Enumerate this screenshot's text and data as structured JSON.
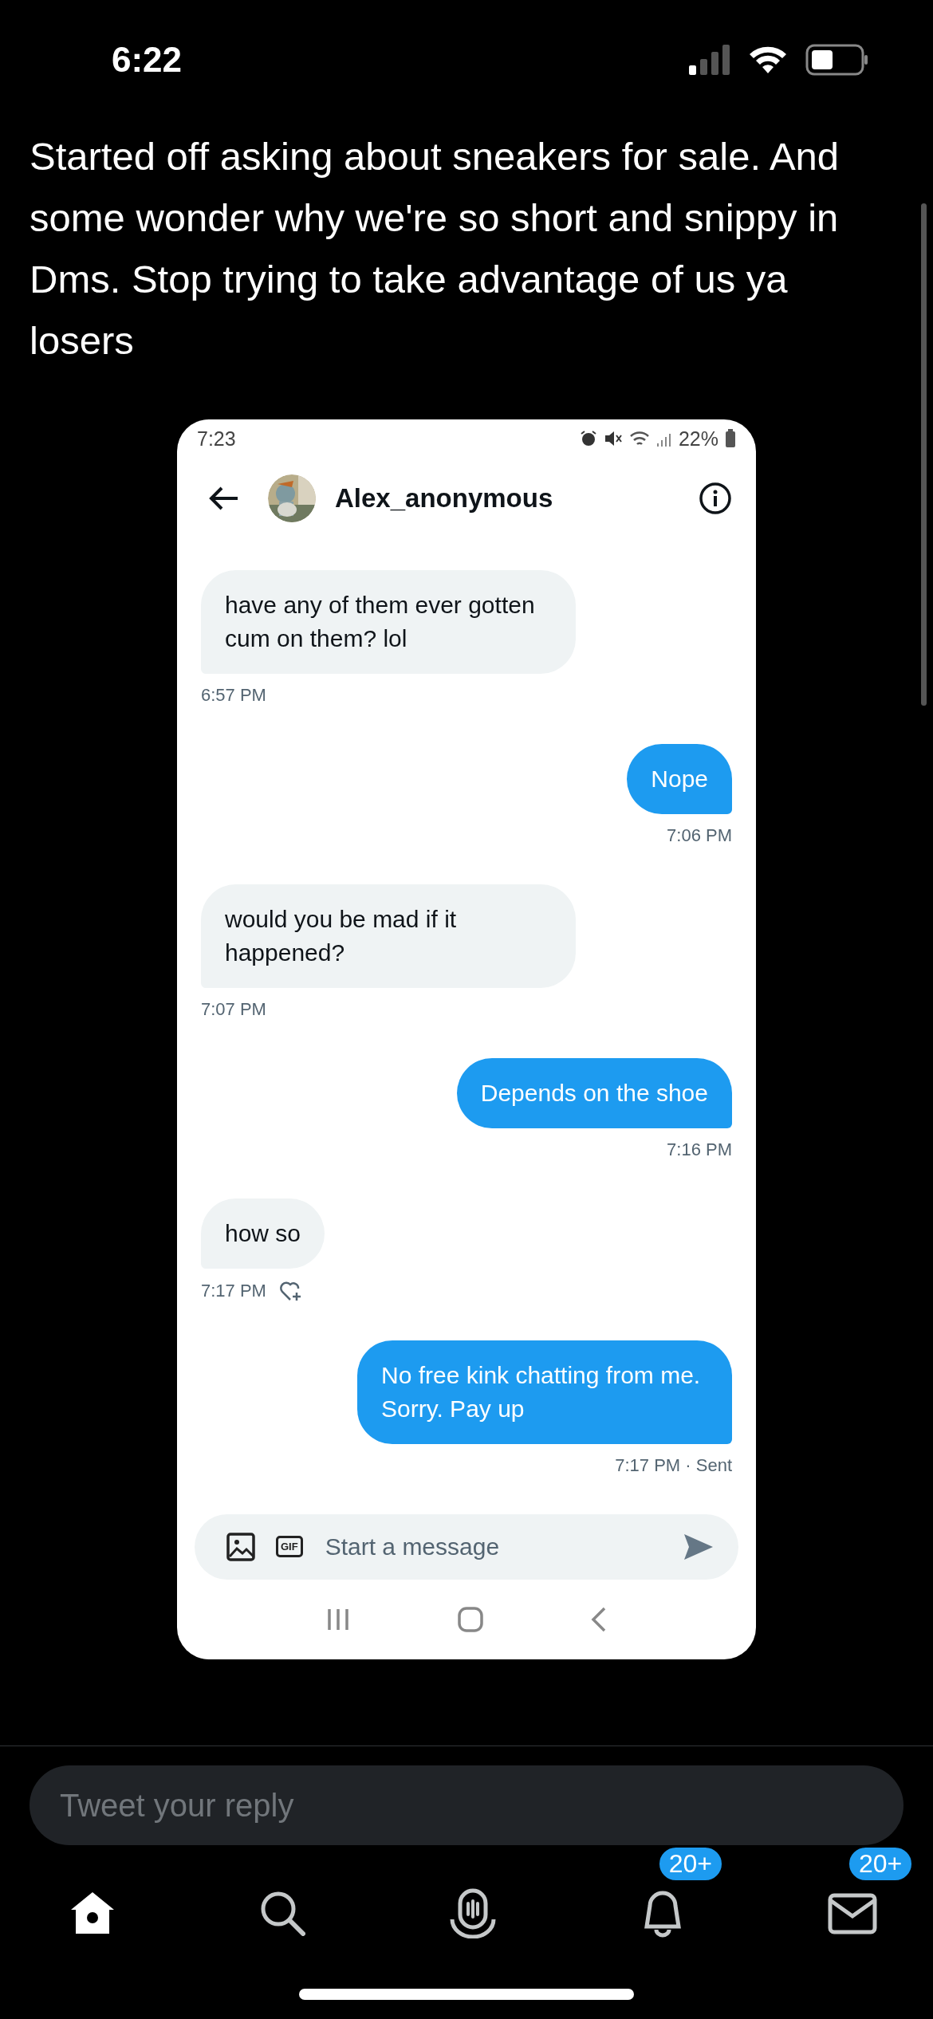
{
  "status_bar": {
    "time": "6:22"
  },
  "tweet": {
    "text": "Started off asking about sneakers for sale. And some wonder why we're so short and snippy in Dms. Stop trying to take advantage of us ya losers"
  },
  "screenshot": {
    "status_bar": {
      "time": "7:23",
      "battery": "22%"
    },
    "header": {
      "name": "Alex_anonymous"
    },
    "messages": [
      {
        "kind": "received",
        "text": "have any of them ever gotten cum on them? lol",
        "time": "6:57 PM",
        "react_icon": false
      },
      {
        "kind": "sent",
        "text": "Nope",
        "time": "7:06 PM",
        "react_icon": false
      },
      {
        "kind": "received",
        "text": "would you be mad if it happened?",
        "time": "7:07 PM",
        "react_icon": false
      },
      {
        "kind": "sent",
        "text": "Depends on the shoe",
        "time": "7:16 PM",
        "react_icon": false
      },
      {
        "kind": "received",
        "text": "how so",
        "time": "7:17 PM",
        "react_icon": true
      },
      {
        "kind": "sent",
        "text": "No free kink chatting from me. Sorry. Pay up",
        "time": "7:17 PM · Sent",
        "react_icon": false
      }
    ],
    "composer": {
      "placeholder": "Start a message",
      "gif": "GIF"
    }
  },
  "reply": {
    "placeholder": "Tweet your reply"
  },
  "tab_bar": [
    {
      "kind": "home",
      "selected": true
    },
    {
      "kind": "search",
      "selected": false
    },
    {
      "kind": "spaces",
      "selected": false
    },
    {
      "kind": "notifications",
      "selected": false,
      "badge": "20+"
    },
    {
      "kind": "messages",
      "selected": false,
      "badge": "20+"
    }
  ]
}
